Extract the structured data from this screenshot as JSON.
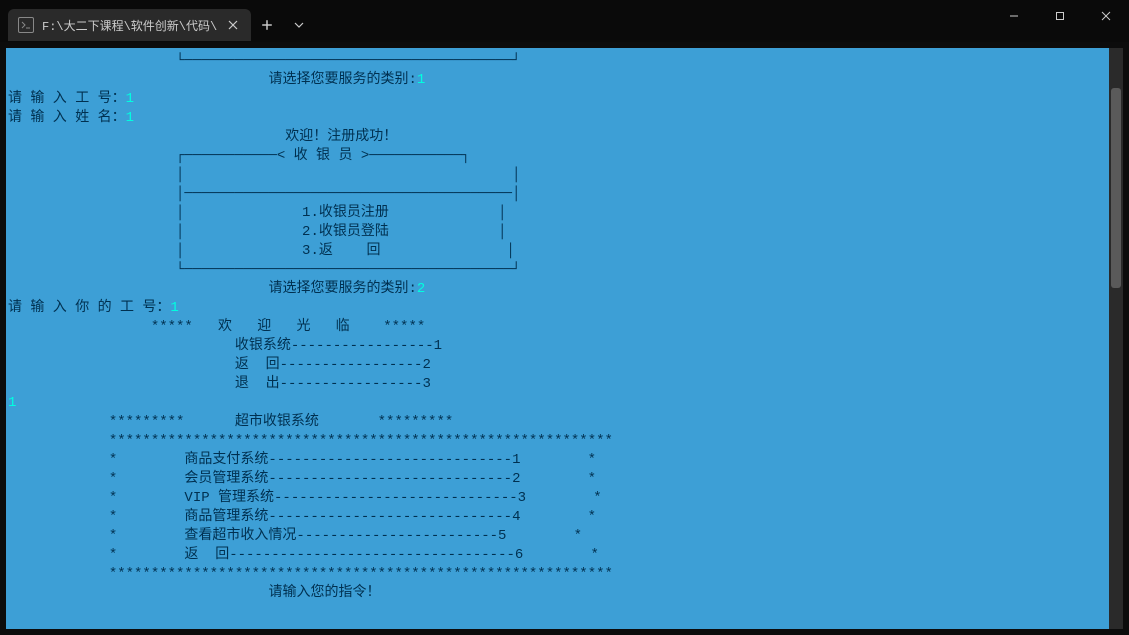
{
  "tab": {
    "title": "F:\\大二下课程\\软件创新\\代码\\"
  },
  "terminal": {
    "line_box_bottom": "                    └───────────────────────────────────────┘",
    "prompt1_label": "                               请选择您要服务的类别:",
    "prompt1_value": "1",
    "input_id_label": "请 输 入 工 号：",
    "input_id_value": "1",
    "input_name_label": "请 输 入 姓 名：",
    "input_name_value": "1",
    "welcome_registered": "                                 欢迎！注册成功！",
    "cashier_box_top": "                    ┌───────────< 收 银 员 >───────────┐",
    "cashier_box_empty": "                    │                                       │",
    "cashier_box_sep": "                    │───────────────────────────────────────│",
    "cashier_opt1": "                    │              1.收银员注册             │",
    "cashier_opt2": "                    │              2.收银员登陆             │",
    "cashier_opt3": "                    │              3.返    回               │",
    "cashier_box_bot": "                    └───────────────────────────────────────┘",
    "prompt2_label": "                               请选择您要服务的类别:",
    "prompt2_value": "2",
    "input_myid_label": "请 输 入 你 的 工 号：",
    "input_myid_value": "1",
    "welcome_banner": "                 *****   欢   迎   光   临    *****",
    "menu_cashier": "                           收银系统-----------------1",
    "menu_back": "                           返  回-----------------2",
    "menu_exit": "                           退  出-----------------3",
    "selection": "1",
    "market_title": "            *********      超市收银系统       *********",
    "market_border": "            ************************************************************",
    "market_opt1": "            *        商品支付系统-----------------------------1        *",
    "market_opt2": "            *        会员管理系统-----------------------------2        *",
    "market_opt3": "            *        VIP 管理系统-----------------------------3        *",
    "market_opt4": "            *        商品管理系统-----------------------------4        *",
    "market_opt5": "            *        查看超市收入情况------------------------5        *",
    "market_opt6": "            *        返  回----------------------------------6        *",
    "market_prompt": "                               请输入您的指令！"
  }
}
